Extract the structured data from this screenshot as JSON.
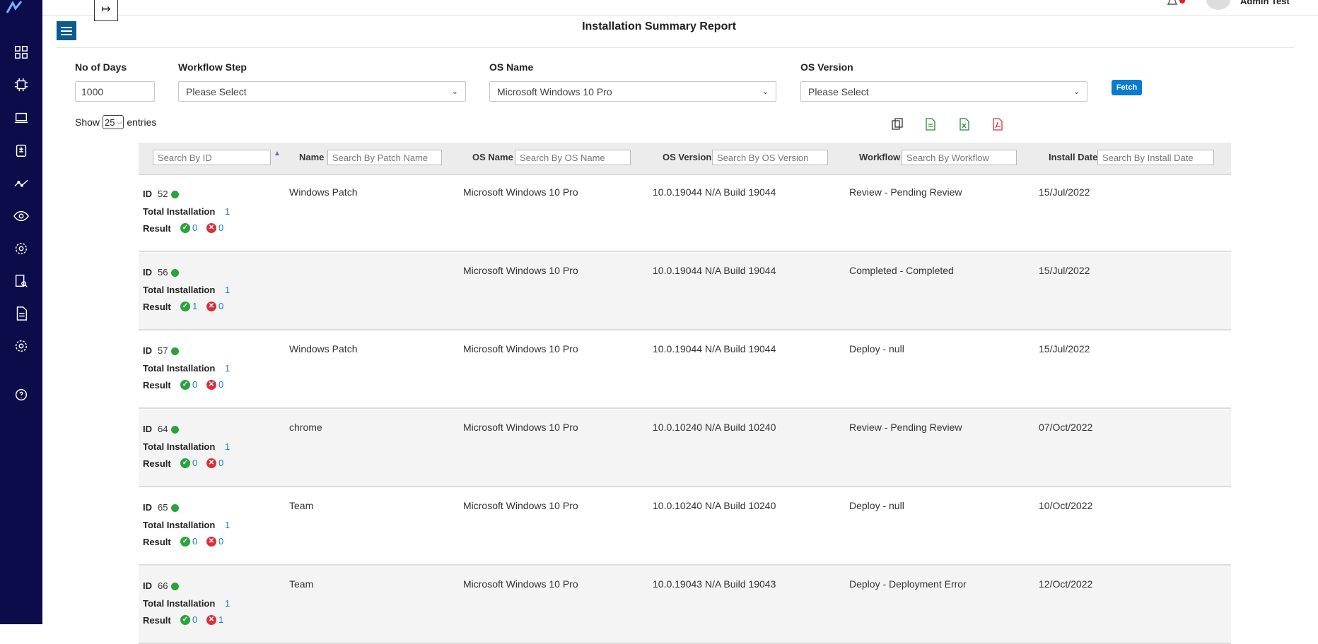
{
  "app": {
    "user_name": "Admin Test"
  },
  "page": {
    "title": "Installation Summary Report"
  },
  "filters": {
    "no_of_days_label": "No of Days",
    "no_of_days_value": "1000",
    "workflow_step_label": "Workflow Step",
    "workflow_step_value": "Please Select",
    "os_name_label": "OS Name",
    "os_name_value": "Microsoft Windows 10 Pro",
    "os_version_label": "OS Version",
    "os_version_value": "Please Select",
    "fetch_label": "Fetch"
  },
  "entries": {
    "show_label": "Show",
    "length_value": "25",
    "entries_label": "entries"
  },
  "table": {
    "columns": [
      {
        "label": "",
        "placeholder": "Search By ID"
      },
      {
        "label": "Name",
        "placeholder": "Search By Patch Name"
      },
      {
        "label": "OS Name",
        "placeholder": "Search By OS Name"
      },
      {
        "label": "OS Version",
        "placeholder": "Search By OS Version"
      },
      {
        "label": "Workflow",
        "placeholder": "Search By Workflow"
      },
      {
        "label": "Install Date",
        "placeholder": "Search By Install Date"
      }
    ],
    "row_labels": {
      "id": "ID",
      "total_installation": "Total Installation",
      "result": "Result"
    },
    "rows": [
      {
        "id": "52",
        "total": "1",
        "ok": "0",
        "err": "0",
        "name": "Windows Patch",
        "os_name": "Microsoft Windows 10 Pro",
        "os_version": "10.0.19044 N/A Build 19044",
        "workflow": "Review - Pending Review",
        "install_date": "15/Jul/2022"
      },
      {
        "id": "56",
        "total": "1",
        "ok": "1",
        "err": "0",
        "name": "",
        "os_name": "Microsoft Windows 10 Pro",
        "os_version": "10.0.19044 N/A Build 19044",
        "workflow": "Completed - Completed",
        "install_date": "15/Jul/2022"
      },
      {
        "id": "57",
        "total": "1",
        "ok": "0",
        "err": "0",
        "name": "Windows Patch",
        "os_name": "Microsoft Windows 10 Pro",
        "os_version": "10.0.19044 N/A Build 19044",
        "workflow": "Deploy - null",
        "install_date": "15/Jul/2022"
      },
      {
        "id": "64",
        "total": "1",
        "ok": "0",
        "err": "0",
        "name": "chrome",
        "os_name": "Microsoft Windows 10 Pro",
        "os_version": "10.0.10240 N/A Build 10240",
        "workflow": "Review - Pending Review",
        "install_date": "07/Oct/2022"
      },
      {
        "id": "65",
        "total": "1",
        "ok": "0",
        "err": "0",
        "name": "Team",
        "os_name": "Microsoft Windows 10 Pro",
        "os_version": "10.0.10240 N/A Build 10240",
        "workflow": "Deploy - null",
        "install_date": "10/Oct/2022"
      },
      {
        "id": "66",
        "total": "1",
        "ok": "0",
        "err": "1",
        "name": "Team",
        "os_name": "Microsoft Windows 10 Pro",
        "os_version": "10.0.19043 N/A Build 19043",
        "workflow": "Deploy - Deployment Error",
        "install_date": "12/Oct/2022"
      }
    ]
  },
  "icons": {
    "sidebar": [
      "dashboard-icon",
      "chip-icon",
      "laptop-icon",
      "clipboard-icon",
      "analytics-icon",
      "eye-icon",
      "settings-icon",
      "search-document-icon",
      "document-icon",
      "gear-icon",
      "help-icon"
    ],
    "export": [
      "copy-icon",
      "csv-icon",
      "excel-icon",
      "pdf-icon"
    ]
  },
  "colors": {
    "sidebar": "#0d0c4a",
    "primary": "#0a7bd0",
    "success": "#2aa23d",
    "danger": "#d8303b"
  }
}
